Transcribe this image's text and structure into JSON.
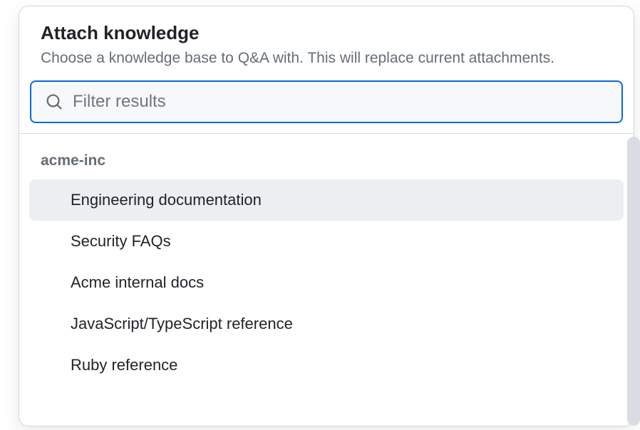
{
  "dialog": {
    "title": "Attach knowledge",
    "subtitle": "Choose a knowledge base to Q&A with. This will replace current attachments."
  },
  "search": {
    "placeholder": "Filter results",
    "value": ""
  },
  "group": {
    "label": "acme-inc"
  },
  "results": [
    {
      "label": "Engineering documentation",
      "selected": true
    },
    {
      "label": "Security FAQs",
      "selected": false
    },
    {
      "label": "Acme internal docs",
      "selected": false
    },
    {
      "label": "JavaScript/TypeScript reference",
      "selected": false
    },
    {
      "label": "Ruby reference",
      "selected": false
    }
  ]
}
